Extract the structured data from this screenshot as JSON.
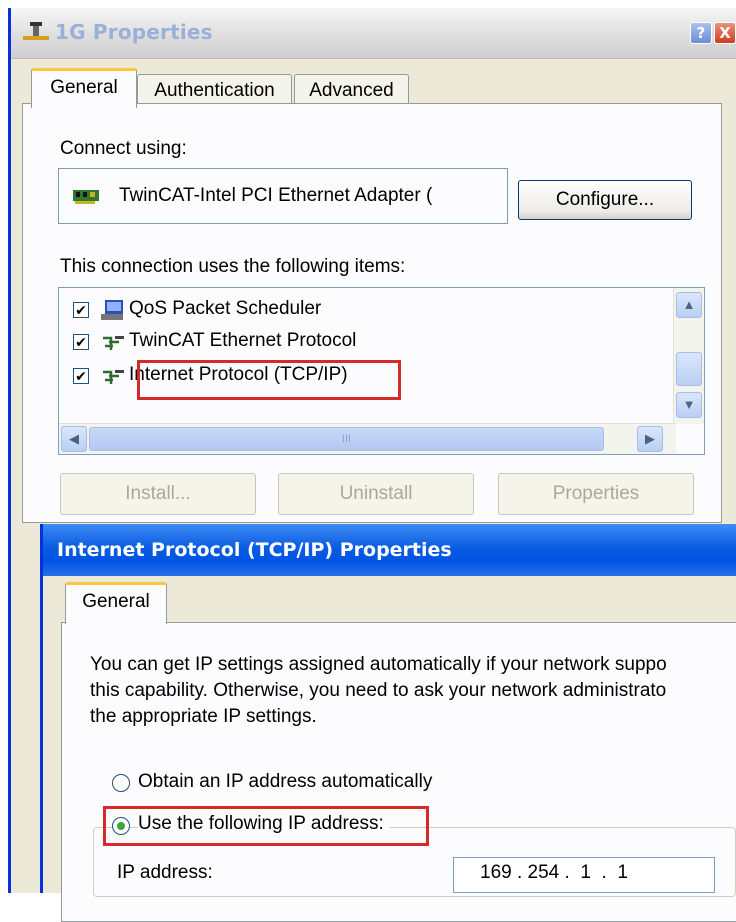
{
  "window1": {
    "title": "1G Properties",
    "help_glyph": "?",
    "close_glyph": "X",
    "tabs": [
      {
        "label": "General",
        "active": true
      },
      {
        "label": "Authentication",
        "active": false
      },
      {
        "label": "Advanced",
        "active": false
      }
    ],
    "connect_using_label": "Connect using:",
    "adapter_name": "TwinCAT-Intel PCI Ethernet Adapter (",
    "configure_button": "Configure...",
    "items_label": "This connection uses the following items:",
    "items": [
      {
        "label": "QoS Packet Scheduler",
        "checked": true,
        "icon": "network-computer-icon"
      },
      {
        "label": "TwinCAT Ethernet Protocol",
        "checked": true,
        "icon": "protocol-icon"
      },
      {
        "label": "Internet Protocol (TCP/IP)",
        "checked": true,
        "icon": "protocol-icon",
        "highlighted": true
      }
    ],
    "checkbox_glyph": "✔",
    "scroll": {
      "up": "▲",
      "down": "▼",
      "left": "◀",
      "right": "▶",
      "grip": "III"
    },
    "buttons": {
      "install": "Install...",
      "uninstall": "Uninstall",
      "properties": "Properties"
    },
    "accent_highlight": "#d32a2a"
  },
  "window2": {
    "title": "Internet Protocol (TCP/IP) Properties",
    "tab": "General",
    "description": [
      "You can get IP settings assigned automatically if your network suppo",
      "this capability. Otherwise, you need to ask your network administrato",
      "the appropriate IP settings."
    ],
    "radio_auto": {
      "label": "Obtain an IP address automatically",
      "selected": false
    },
    "radio_manual": {
      "label": "Use the following IP address:",
      "selected": true
    },
    "ip_label": "IP address:",
    "ip_value": "169 . 254 .  1  .  1"
  }
}
